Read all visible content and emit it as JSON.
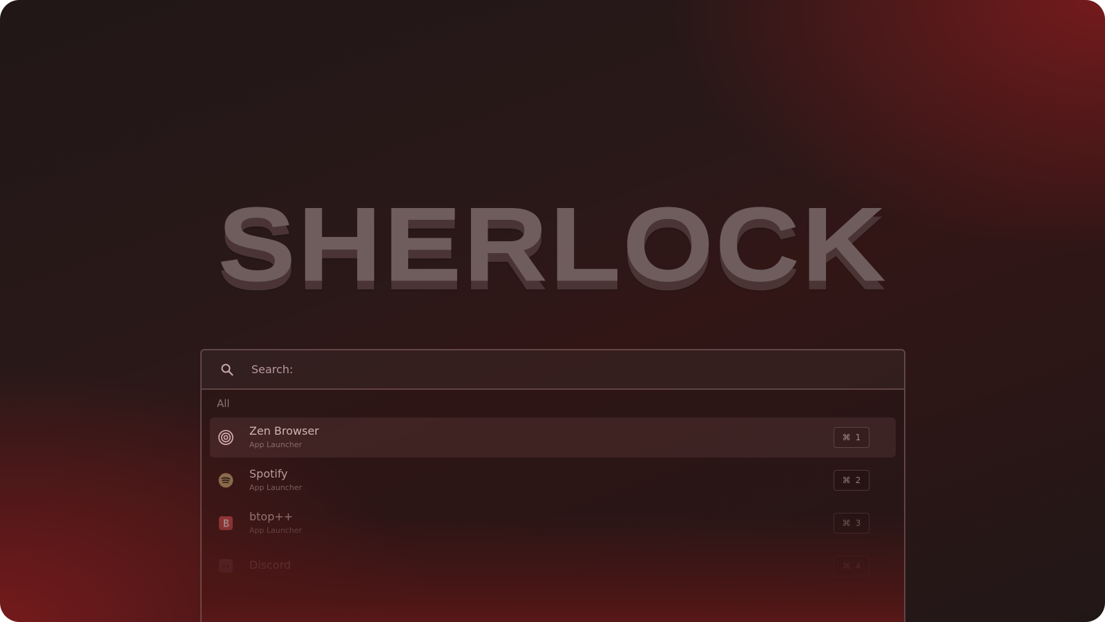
{
  "logo": {
    "text": "SHERLOCK"
  },
  "search": {
    "placeholder": "Search:",
    "value": ""
  },
  "results": {
    "section_label": "All",
    "items": [
      {
        "name": "Zen Browser",
        "subtitle": "App Launcher",
        "shortcut_symbol": "⌘",
        "shortcut_key": "1",
        "icon": "zen-browser-icon",
        "active": true
      },
      {
        "name": "Spotify",
        "subtitle": "App Launcher",
        "shortcut_symbol": "⌘",
        "shortcut_key": "2",
        "icon": "spotify-icon",
        "active": false
      },
      {
        "name": "btop++",
        "subtitle": "App Launcher",
        "shortcut_symbol": "⌘",
        "shortcut_key": "3",
        "icon": "btop-icon",
        "active": false
      },
      {
        "name": "Discord",
        "subtitle": "",
        "shortcut_symbol": "⌘",
        "shortcut_key": "4",
        "icon": "discord-icon",
        "active": false
      }
    ]
  },
  "colors": {
    "accent_red": "#7a1a1c",
    "background_dark": "#221717",
    "logo_text": "#6f5d5d",
    "row_active": "#4a2a2a"
  }
}
